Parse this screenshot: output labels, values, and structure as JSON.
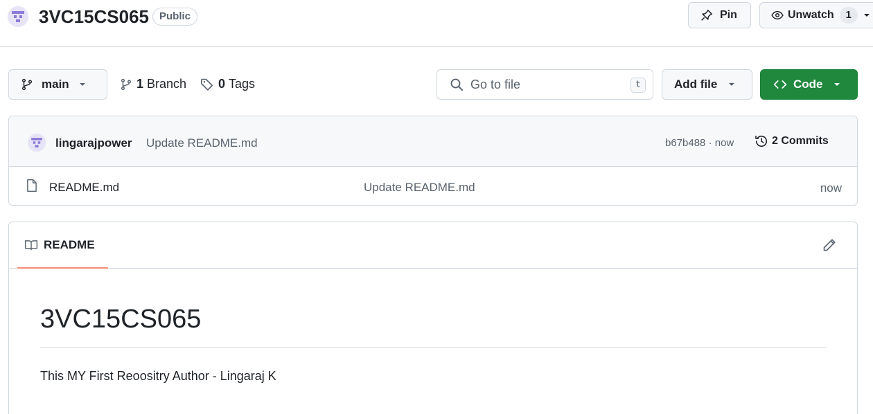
{
  "repo": {
    "name": "3VC15CS065",
    "visibility": "Public"
  },
  "header_actions": {
    "pin_label": "Pin",
    "watch_label": "Unwatch",
    "watch_count": "1"
  },
  "toolbar": {
    "branch_name": "main",
    "branch_count": "1",
    "branch_label": "Branch",
    "tag_count": "0",
    "tag_label": "Tags",
    "search_placeholder": "Go to file",
    "search_shortcut": "t",
    "add_file_label": "Add file",
    "code_label": "Code"
  },
  "latest_commit": {
    "author": "lingarajpower",
    "message": "Update README.md",
    "meta": "b67b488 · now",
    "commits_label": "2 Commits"
  },
  "files": [
    {
      "name": "README.md",
      "commit_message": "Update README.md",
      "time": "now"
    }
  ],
  "readme": {
    "tab_label": "README",
    "title": "3VC15CS065",
    "body": "This MY First Reoositry Author - Lingaraj K"
  },
  "colors": {
    "code_button": "#1f883d",
    "tab_underline": "#fd8c73",
    "avatar_accent": "#8c7ad8"
  }
}
